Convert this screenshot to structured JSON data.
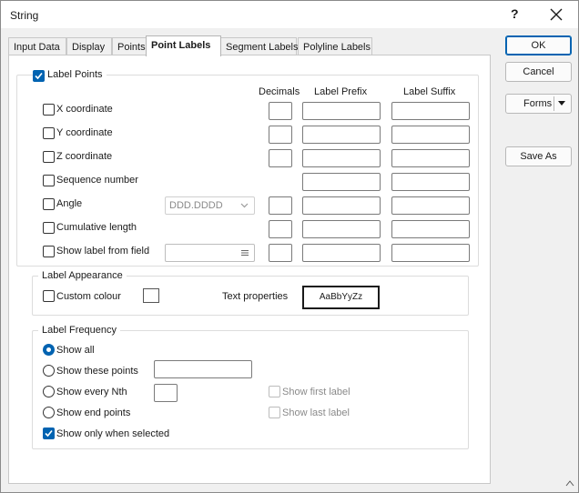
{
  "window": {
    "title": "String",
    "help_label": "?"
  },
  "tabs": [
    {
      "label": "Input Data",
      "active": false
    },
    {
      "label": "Display",
      "active": false
    },
    {
      "label": "Points",
      "active": false
    },
    {
      "label": "Point Labels",
      "active": true
    },
    {
      "label": "Segment Labels",
      "active": false
    },
    {
      "label": "Polyline Labels",
      "active": false
    }
  ],
  "buttons": {
    "ok": "OK",
    "cancel": "Cancel",
    "forms": "Forms",
    "save_as": "Save As"
  },
  "label_points": {
    "label": "Label Points",
    "checked": true,
    "columns": {
      "decimals": "Decimals",
      "prefix": "Label Prefix",
      "suffix": "Label Suffix"
    },
    "rows": [
      {
        "label": "X coordinate",
        "checked": false
      },
      {
        "label": "Y coordinate",
        "checked": false
      },
      {
        "label": "Z coordinate",
        "checked": false
      },
      {
        "label": "Sequence number",
        "checked": false
      },
      {
        "label": "Angle",
        "checked": false
      },
      {
        "label": "Cumulative length",
        "checked": false
      },
      {
        "label": "Show label from field",
        "checked": false
      }
    ],
    "angle_format": "DDD.DDDD"
  },
  "label_appearance": {
    "title": "Label Appearance",
    "custom_colour": "Custom colour",
    "text_properties": "Text properties",
    "sample": "AaBbYyZz"
  },
  "label_frequency": {
    "title": "Label Frequency",
    "options": [
      {
        "label": "Show all",
        "selected": true
      },
      {
        "label": "Show these points",
        "selected": false
      },
      {
        "label": "Show every Nth",
        "selected": false
      },
      {
        "label": "Show end points",
        "selected": false
      }
    ],
    "show_first_label": "Show first label",
    "show_last_label": "Show last label",
    "show_only_when_selected": "Show only when selected"
  },
  "colors": {
    "accent": "#0063b1",
    "panel": "#ffffff",
    "dialog": "#f0f0f0"
  }
}
